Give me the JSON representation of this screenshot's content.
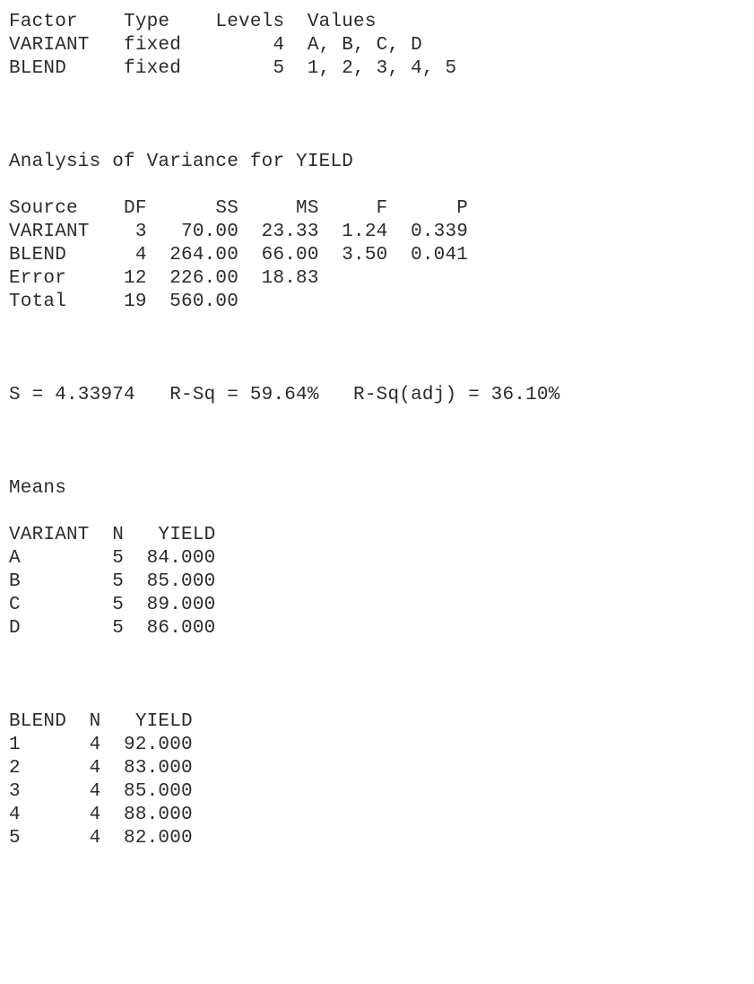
{
  "document": {
    "kind": "statistical-software-output",
    "software_style": "Minitab ANOVA (General Linear Model) text output",
    "response_variable": "YIELD"
  },
  "factor_table": {
    "headers": [
      "Factor",
      "Type",
      "Levels",
      "Values"
    ],
    "rows": [
      {
        "factor": "VARIANT",
        "type": "fixed",
        "levels": "4",
        "values": "A, B, C, D"
      },
      {
        "factor": "BLEND",
        "type": "fixed",
        "levels": "5",
        "values": "1, 2, 3, 4, 5"
      }
    ],
    "line_header": "Factor    Type    Levels  Values",
    "line_row_1": "VARIANT   fixed        4  A, B, C, D",
    "line_row_2": "BLEND     fixed        5  1, 2, 3, 4, 5"
  },
  "anova": {
    "title": "Analysis of Variance for YIELD",
    "headers": [
      "Source",
      "DF",
      "SS",
      "MS",
      "F",
      "P"
    ],
    "rows": [
      {
        "source": "VARIANT",
        "df": "3",
        "ss": "70.00",
        "ms": "23.33",
        "f": "1.24",
        "p": "0.339"
      },
      {
        "source": "BLEND",
        "df": "4",
        "ss": "264.00",
        "ms": "66.00",
        "f": "3.50",
        "p": "0.041"
      },
      {
        "source": "Error",
        "df": "12",
        "ss": "226.00",
        "ms": "18.83",
        "f": "",
        "p": ""
      },
      {
        "source": "Total",
        "df": "19",
        "ss": "560.00",
        "ms": "",
        "f": "",
        "p": ""
      }
    ],
    "line_header": "Source    DF      SS     MS     F      P",
    "line_row_1": "VARIANT    3   70.00  23.33  1.24  0.339",
    "line_row_2": "BLEND      4  264.00  66.00  3.50  0.041",
    "line_row_3": "Error     12  226.00  18.83",
    "line_row_4": "Total     19  560.00"
  },
  "model_summary": {
    "s_label": "S",
    "s_value": "4.33974",
    "rsq_label": "R-Sq",
    "rsq_value": "59.64%",
    "rsq_adj_label": "R-Sq(adj)",
    "rsq_adj_value": "36.10%",
    "line": "S = 4.33974   R-Sq = 59.64%   R-Sq(adj) = 36.10%"
  },
  "means": {
    "title": "Means",
    "variant_table": {
      "headers": [
        "VARIANT",
        "N",
        "YIELD"
      ],
      "rows": [
        {
          "level": "A",
          "n": "5",
          "yield": "84.000"
        },
        {
          "level": "B",
          "n": "5",
          "yield": "85.000"
        },
        {
          "level": "C",
          "n": "5",
          "yield": "89.000"
        },
        {
          "level": "D",
          "n": "5",
          "yield": "86.000"
        }
      ],
      "line_header": "VARIANT  N   YIELD",
      "line_row_1": "A        5  84.000",
      "line_row_2": "B        5  85.000",
      "line_row_3": "C        5  89.000",
      "line_row_4": "D        5  86.000"
    },
    "blend_table": {
      "headers": [
        "BLEND",
        "N",
        "YIELD"
      ],
      "rows": [
        {
          "level": "1",
          "n": "4",
          "yield": "92.000"
        },
        {
          "level": "2",
          "n": "4",
          "yield": "83.000"
        },
        {
          "level": "3",
          "n": "4",
          "yield": "85.000"
        },
        {
          "level": "4",
          "n": "4",
          "yield": "88.000"
        },
        {
          "level": "5",
          "n": "4",
          "yield": "82.000"
        }
      ],
      "line_header": "BLEND  N   YIELD",
      "line_row_1": "1      4  92.000",
      "line_row_2": "2      4  83.000",
      "line_row_3": "3      4  85.000",
      "line_row_4": "4      4  88.000",
      "line_row_5": "5      4  82.000"
    }
  },
  "colors": {
    "text": "#2b2b2b",
    "background": "#ffffff"
  }
}
